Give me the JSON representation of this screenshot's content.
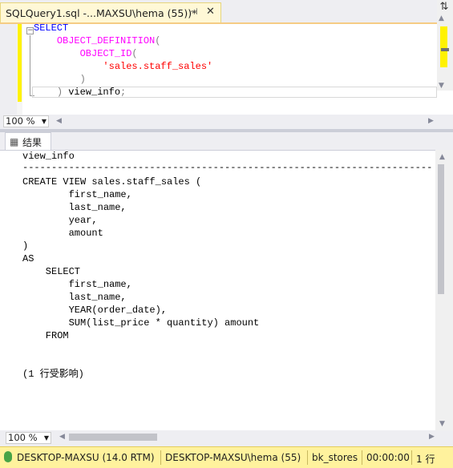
{
  "tab": {
    "title": "SQLQuery1.sql -...MAXSU\\hema (55))*",
    "pin_glyph": "⊣",
    "close_glyph": "✕",
    "dropdown_glyph": "▼"
  },
  "editor": {
    "code": {
      "line1": "SELECT",
      "line2_fn": "OBJECT_DEFINITION",
      "line2_paren": "(",
      "line3_fn": "OBJECT_ID",
      "line3_paren": "(",
      "line4_str": "'sales.staff_sales'",
      "line5_paren": ")",
      "line6_paren": ")",
      "line6_alias": " view_info",
      "line6_semi": ";"
    },
    "zoom": "100 %",
    "split_glyph": "⇅",
    "outline_glyph": "−"
  },
  "results": {
    "tab_label": "结果",
    "column_header": "view_info",
    "divider": "--------------------------------------------------------------------------------------------------------------------",
    "lines": [
      "CREATE VIEW sales.staff_sales (",
      "        first_name,",
      "        last_name,",
      "        year,",
      "        amount",
      ")",
      "AS",
      "    SELECT",
      "        first_name,",
      "        last_name,",
      "        YEAR(order_date),",
      "        SUM(list_price * quantity) amount",
      "    FROM",
      "",
      "",
      "(1 行受影响)"
    ],
    "zoom": "100 %"
  },
  "status": {
    "server": "DESKTOP-MAXSU (14.0 RTM)",
    "user": "DESKTOP-MAXSU\\hema (55)",
    "database": "bk_stores",
    "elapsed": "00:00:00",
    "rows": "1 行"
  },
  "colors": {
    "keyword": "#0000ff",
    "function": "#ff00ff",
    "string": "#ff0000",
    "statusbar": "#fff29d"
  }
}
